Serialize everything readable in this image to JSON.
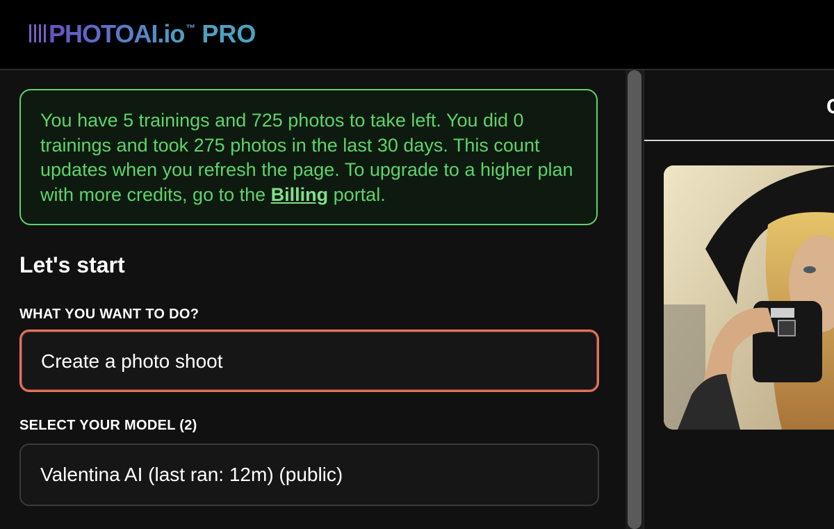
{
  "header": {
    "logo_text": "PHOTOAI.io",
    "logo_tm": "™",
    "logo_pro": "PRO"
  },
  "info": {
    "text_before_link": "You have 5 trainings and 725 photos to take left. You did 0 trainings and took 275 photos in the last 30 days. This count updates when you refresh the page. To upgrade to a higher plan with more credits, go to the ",
    "link_label": "Billing",
    "text_after_link": " portal."
  },
  "start": {
    "title": "Let's start",
    "task_label": "WHAT YOU WANT TO DO?",
    "task_value": "Create a photo shoot",
    "model_label": "SELECT YOUR MODEL (2)",
    "model_value": "Valentina AI (last ran: 12m) (public)"
  },
  "right": {
    "tab_label": "C"
  },
  "colors": {
    "notice_green": "#5ed36a",
    "accent_orange": "#e0735c",
    "logo_blue": "#4aa3c3"
  }
}
